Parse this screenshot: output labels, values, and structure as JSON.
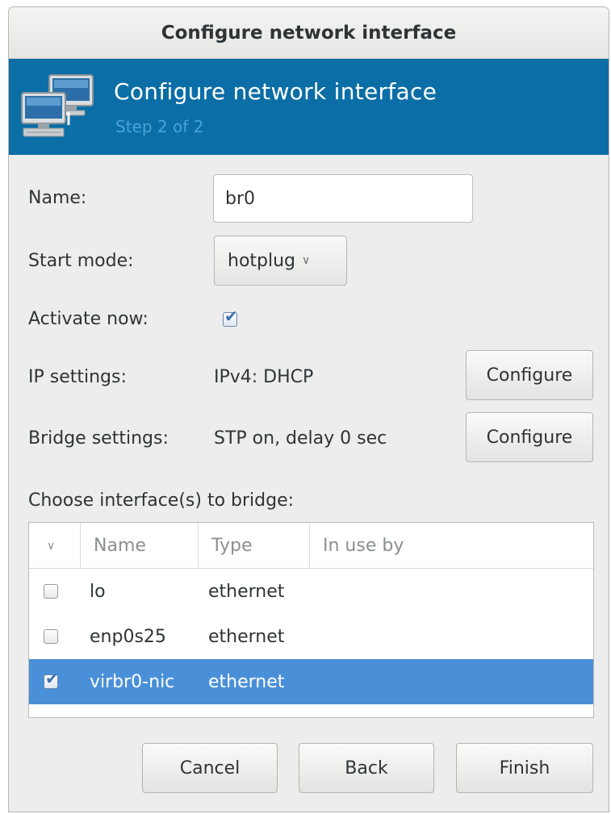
{
  "window": {
    "title": "Configure network interface"
  },
  "banner": {
    "title": "Configure network interface",
    "step": "Step 2 of 2",
    "icon": "network-computers-icon"
  },
  "form": {
    "name_label": "Name:",
    "name_value": "br0",
    "start_mode_label": "Start mode:",
    "start_mode_value": "hotplug",
    "activate_label": "Activate now:",
    "activate_checked": true,
    "ip_label": "IP settings:",
    "ip_value": "IPv4: DHCP",
    "ip_configure": "Configure",
    "bridge_label": "Bridge settings:",
    "bridge_value": "STP on, delay 0 sec",
    "bridge_configure": "Configure"
  },
  "interfaces": {
    "label": "Choose interface(s) to bridge:",
    "columns": [
      "Name",
      "Type",
      "In use by"
    ],
    "rows": [
      {
        "checked": false,
        "name": "lo",
        "type": "ethernet",
        "in_use_by": ""
      },
      {
        "checked": false,
        "name": "enp0s25",
        "type": "ethernet",
        "in_use_by": ""
      },
      {
        "checked": true,
        "name": "virbr0-nic",
        "type": "ethernet",
        "in_use_by": "",
        "selected": true
      }
    ]
  },
  "buttons": {
    "cancel": "Cancel",
    "back": "Back",
    "finish": "Finish"
  },
  "colors": {
    "banner": "#0b6ea6",
    "selection": "#4a90d9",
    "step_text": "#4aa2d8"
  }
}
